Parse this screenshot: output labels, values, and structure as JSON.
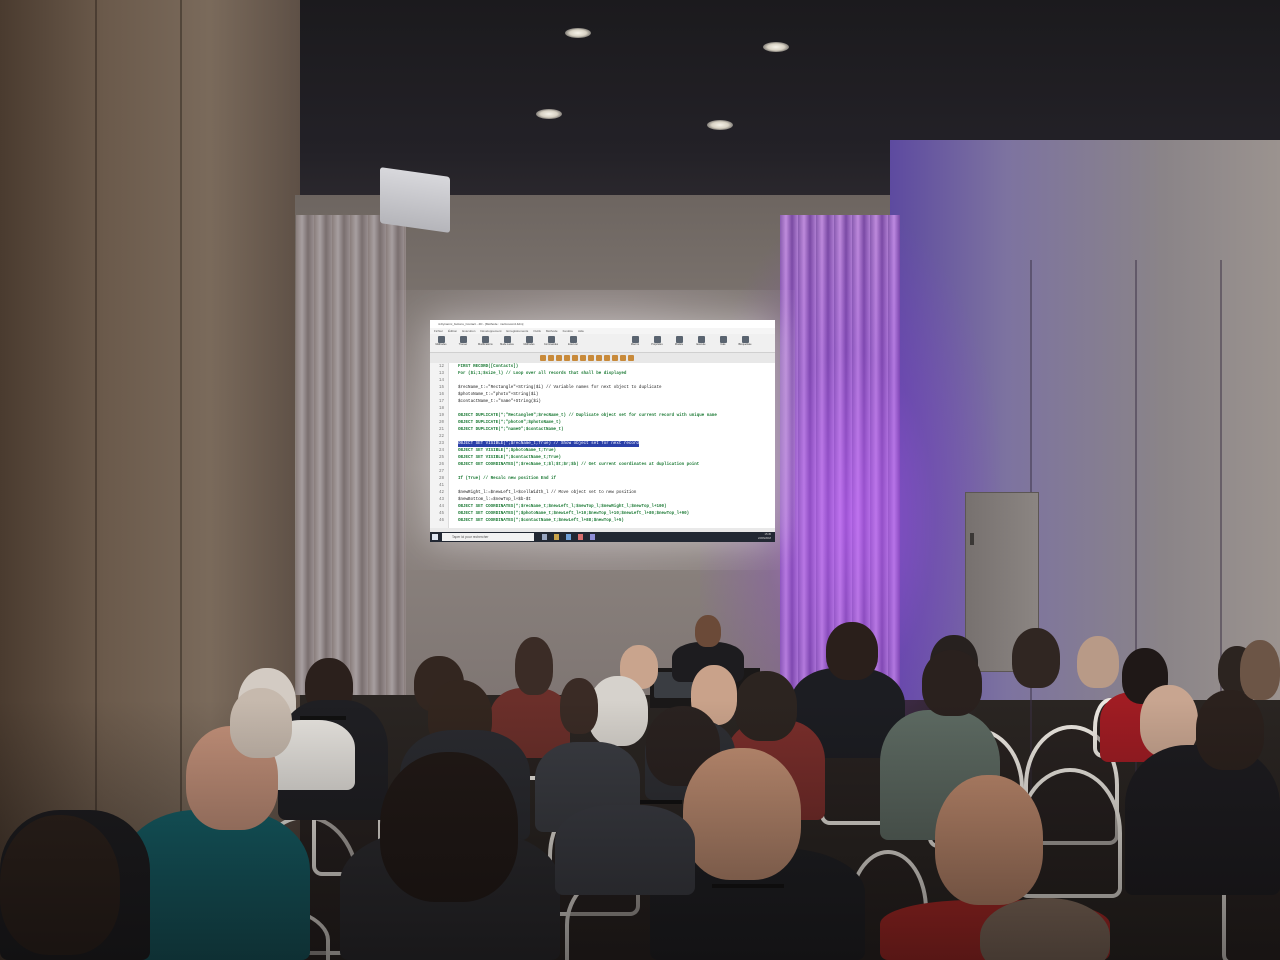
{
  "scene": {
    "description_tags": [
      "conference-room",
      "projector-screen",
      "audience",
      "presenter"
    ],
    "accent_purple": "#b46cf0",
    "screen_bg": "#eceff3"
  },
  "screen": {
    "title_bar": "4-Dynamic_buttons_Contact - 4D - [Méthode : multi-record.4dm]",
    "menu_items": [
      "Fichier",
      "Édition",
      "Exécution",
      "Développement",
      "Enregistrements",
      "Outils",
      "Méthode",
      "Fenêtre",
      "Aide"
    ],
    "ribbon_buttons": [
      "Méthodes",
      "Trouver",
      "Modifications",
      "Mode Lance",
      "Méthodes",
      "Commandes",
      "Exécuter",
      "Macros",
      "Propriétés",
      "Modèle",
      "Exécute",
      "Calé",
      "Bloquetisée"
    ],
    "code_lines": [
      {
        "n": "12",
        "text": "FIRST RECORD([Contacts])"
      },
      {
        "n": "13",
        "text": "For ($i;1;$size_l)  // Loop over all records that shall be displayed"
      },
      {
        "n": "14",
        "text": ""
      },
      {
        "n": "15",
        "text": "$recName_t:=\"Rectangle\"+String($i)  // Variable names for next object to duplicate"
      },
      {
        "n": "16",
        "text": "$photoName_t:=\"photo\"+String($i)"
      },
      {
        "n": "17",
        "text": "$contactName_t:=\"name\"+String($i)"
      },
      {
        "n": "18",
        "text": ""
      },
      {
        "n": "19",
        "text": "OBJECT DUPLICATE(*;\"Rectangle0\";$recName_t)  // Duplicate object set for current record with unique name"
      },
      {
        "n": "20",
        "text": "OBJECT DUPLICATE(*;\"photo0\";$photoName_t)"
      },
      {
        "n": "21",
        "text": "OBJECT DUPLICATE(*;\"name0\";$contactName_t)"
      },
      {
        "n": "22",
        "text": ""
      },
      {
        "n": "23",
        "text": "OBJECT SET VISIBLE(*;$recName_t;True)  // Show object set for next record",
        "highlight": true
      },
      {
        "n": "24",
        "text": "OBJECT SET VISIBLE(*;$photoName_t;True)"
      },
      {
        "n": "25",
        "text": "OBJECT SET VISIBLE(*;$contactName_t;True)"
      },
      {
        "n": "26",
        "text": "OBJECT GET COORDINATES(*;$recName_t;$l;$t;$r;$b)  // Get current coordinates at duplication point"
      },
      {
        "n": "27",
        "text": ""
      },
      {
        "n": "28",
        "text": "If (True)  // Recalc new position End if"
      },
      {
        "n": "41",
        "text": ""
      },
      {
        "n": "42",
        "text": "$newRight_l:=$newLeft_l+$cellWidth_l  // Move object set to new position"
      },
      {
        "n": "43",
        "text": "$newBottom_l:=$newTop_l+$b-$t"
      },
      {
        "n": "44",
        "text": "OBJECT SET COORDINATES(*;$recName_t;$newLeft_l;$newTop_l;$newRight_l;$newTop_l+100)"
      },
      {
        "n": "45",
        "text": "OBJECT SET COORDINATES(*;$photoName_t;$newLeft_l+10;$newTop_l+10;$newLeft_l+80;$newTop_l+90)"
      },
      {
        "n": "46",
        "text": "OBJECT SET COORDINATES(*;$contactName_t;$newLeft_l+88;$newTop_l+5)"
      }
    ],
    "taskbar": {
      "search_placeholder": "Taper ici pour rechercher",
      "time": "15:45",
      "date": "22/06/2018"
    }
  }
}
